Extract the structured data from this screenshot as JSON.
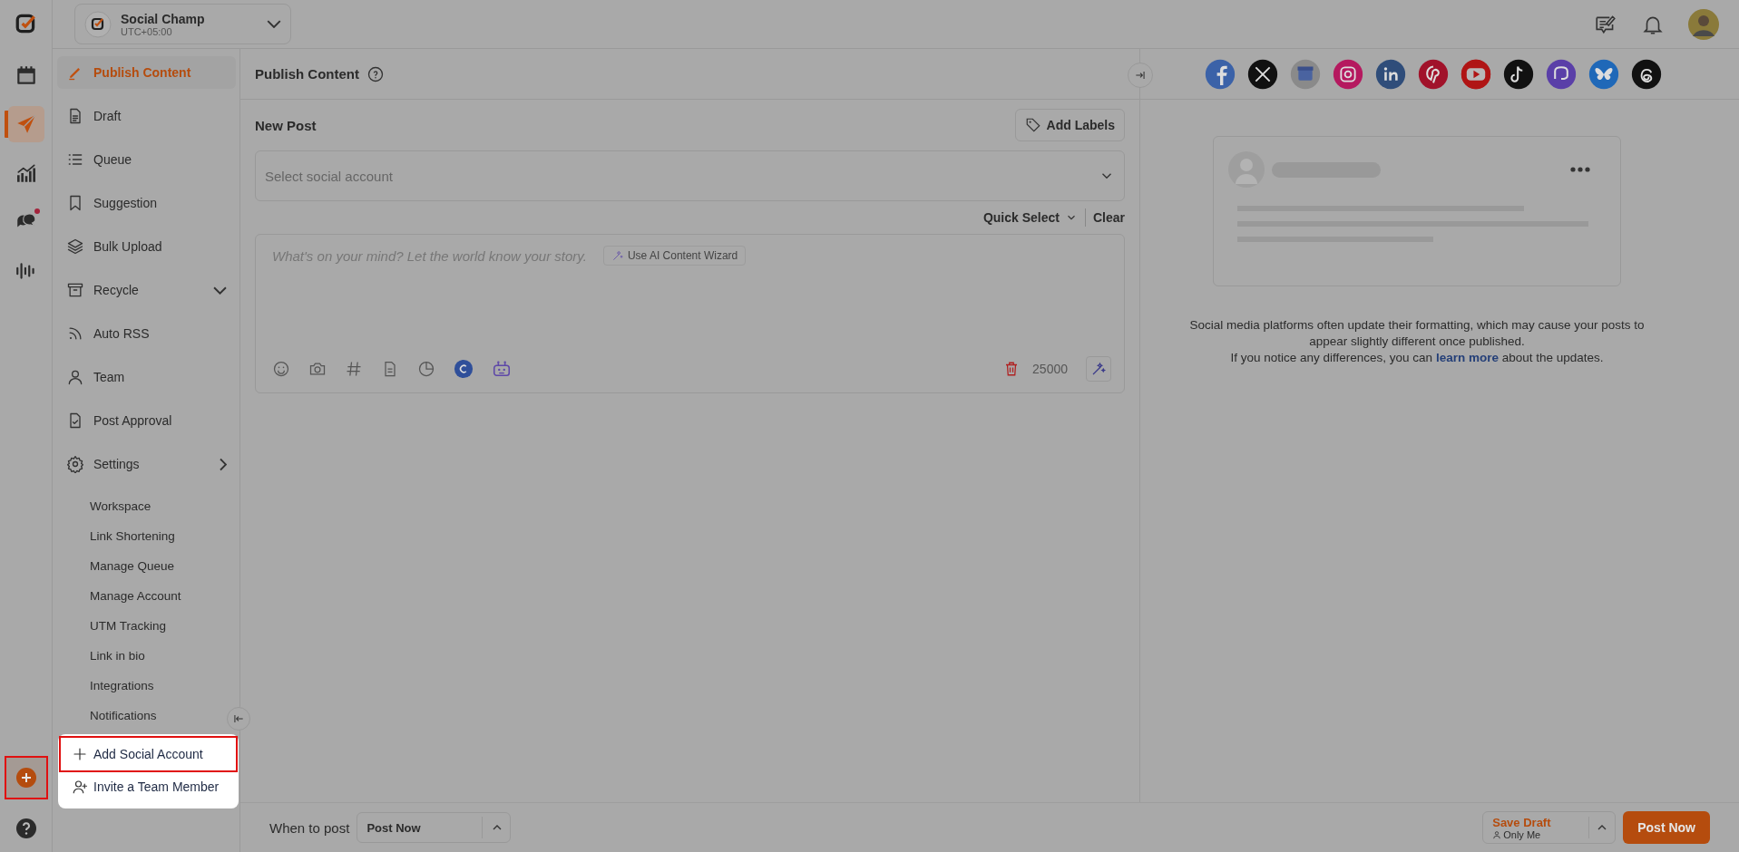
{
  "workspace": {
    "name": "Social Champ",
    "timezone": "UTC+05:00"
  },
  "rail": [
    {
      "kind": "calendar",
      "selected": false,
      "dot": false
    },
    {
      "kind": "send",
      "selected": true,
      "dot": false
    },
    {
      "kind": "analytics",
      "selected": false,
      "dot": false
    },
    {
      "kind": "chat",
      "selected": false,
      "dot": true
    },
    {
      "kind": "wave",
      "selected": false,
      "dot": false
    }
  ],
  "add_button": {
    "highlighted": true
  },
  "sidebar": {
    "items": [
      {
        "kind": "publish",
        "label": "Publish Content",
        "selected": true
      },
      {
        "kind": "draft",
        "label": "Draft",
        "selected": false
      },
      {
        "kind": "queue",
        "label": "Queue",
        "selected": false
      },
      {
        "kind": "suggestion",
        "label": "Suggestion",
        "selected": false
      },
      {
        "kind": "bulk",
        "label": "Bulk Upload",
        "selected": false
      },
      {
        "kind": "recycle",
        "label": "Recycle",
        "selected": false,
        "expanded": false
      },
      {
        "kind": "rss",
        "label": "Auto RSS",
        "selected": false
      },
      {
        "kind": "team",
        "label": "Team",
        "selected": false
      },
      {
        "kind": "approval",
        "label": "Post Approval",
        "selected": false
      },
      {
        "kind": "settings",
        "label": "Settings",
        "selected": false,
        "expanded": true,
        "children": [
          "Workspace",
          "Link Shortening",
          "Manage Queue",
          "Manage Account",
          "UTM Tracking",
          "Link in bio",
          "Integrations",
          "Notifications"
        ]
      }
    ]
  },
  "popup": {
    "items": [
      {
        "kind": "add",
        "label": "Add Social Account",
        "selected": true
      },
      {
        "kind": "invite",
        "label": "Invite a Team Member",
        "selected": false
      }
    ]
  },
  "page": {
    "title": "Publish Content"
  },
  "composer": {
    "heading": "New Post",
    "add_labels": "Add Labels",
    "account_placeholder": "Select social account",
    "quick_select": "Quick Select",
    "clear": "Clear",
    "text_placeholder": "What's on your mind? Let the world know your story.",
    "ai_wizard": "Use AI Content Wizard",
    "char_count": "25000"
  },
  "preview": {
    "notice": "Social media platforms often update their formatting, which may cause your posts to appear slightly different once published.",
    "notice_prefix": "If you notice any differences, you can",
    "link": "learn more",
    "notice_suffix": "about the updates."
  },
  "footer": {
    "when_label": "When to post",
    "schedule": "Post Now",
    "save_draft": "Save Draft",
    "audience": "Only Me",
    "post_now": "Post Now"
  }
}
